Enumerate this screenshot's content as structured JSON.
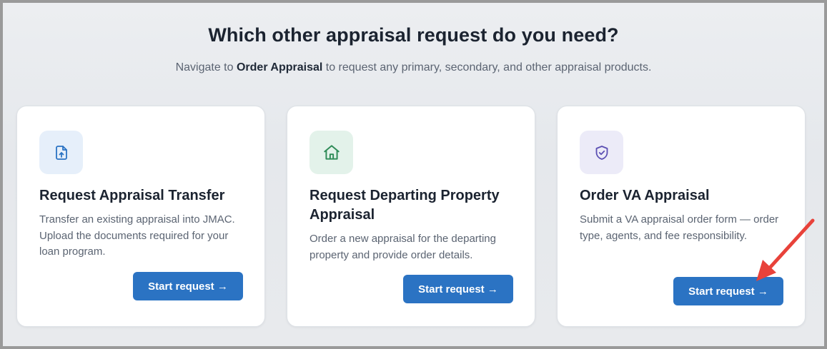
{
  "header": {
    "title": "Which other appraisal request do you need?",
    "subtitle_prefix": "Navigate to ",
    "subtitle_link": "Order Appraisal",
    "subtitle_suffix": " to request any primary, secondary, and other appraisal products."
  },
  "cards": [
    {
      "icon": "file-upload-icon",
      "title": "Request Appraisal Transfer",
      "description": "Transfer an existing appraisal into JMAC. Upload the documents required for your loan program.",
      "button": "Start request →"
    },
    {
      "icon": "home-icon",
      "title": "Request Departing Property Appraisal",
      "description": "Order a new appraisal for the departing property and provide order details.",
      "button": "Start request →"
    },
    {
      "icon": "shield-check-icon",
      "title": "Order VA Appraisal",
      "description": "Submit a VA appraisal order form — order type, agents, and fee responsibility.",
      "button": "Start request →"
    }
  ],
  "colors": {
    "button": "#2b73c3",
    "annotation_arrow": "#e8423a",
    "icon_blue": "#2b73c3",
    "icon_green": "#2e8b57",
    "icon_purple": "#5b4fb3"
  }
}
